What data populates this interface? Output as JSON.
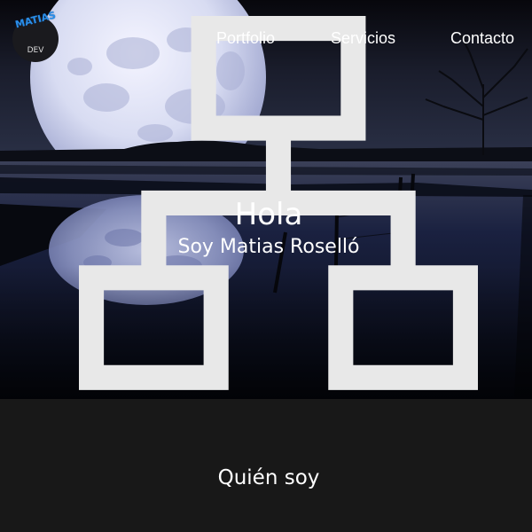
{
  "logo": {
    "name": "MATIAS",
    "sub": "DEV",
    "icon": "sitemap-icon"
  },
  "nav": {
    "items": [
      {
        "label": "Portfolio"
      },
      {
        "label": "Servicios"
      },
      {
        "label": "Contacto"
      }
    ]
  },
  "hero": {
    "title": "Hola",
    "subtitle": "Soy Matias Roselló",
    "background": "night-lake-full-moon-photo"
  },
  "about": {
    "title": "Quién soy"
  },
  "colors": {
    "accent": "#2a8ee8",
    "section_bg": "#181818",
    "text": "#ffffff"
  }
}
